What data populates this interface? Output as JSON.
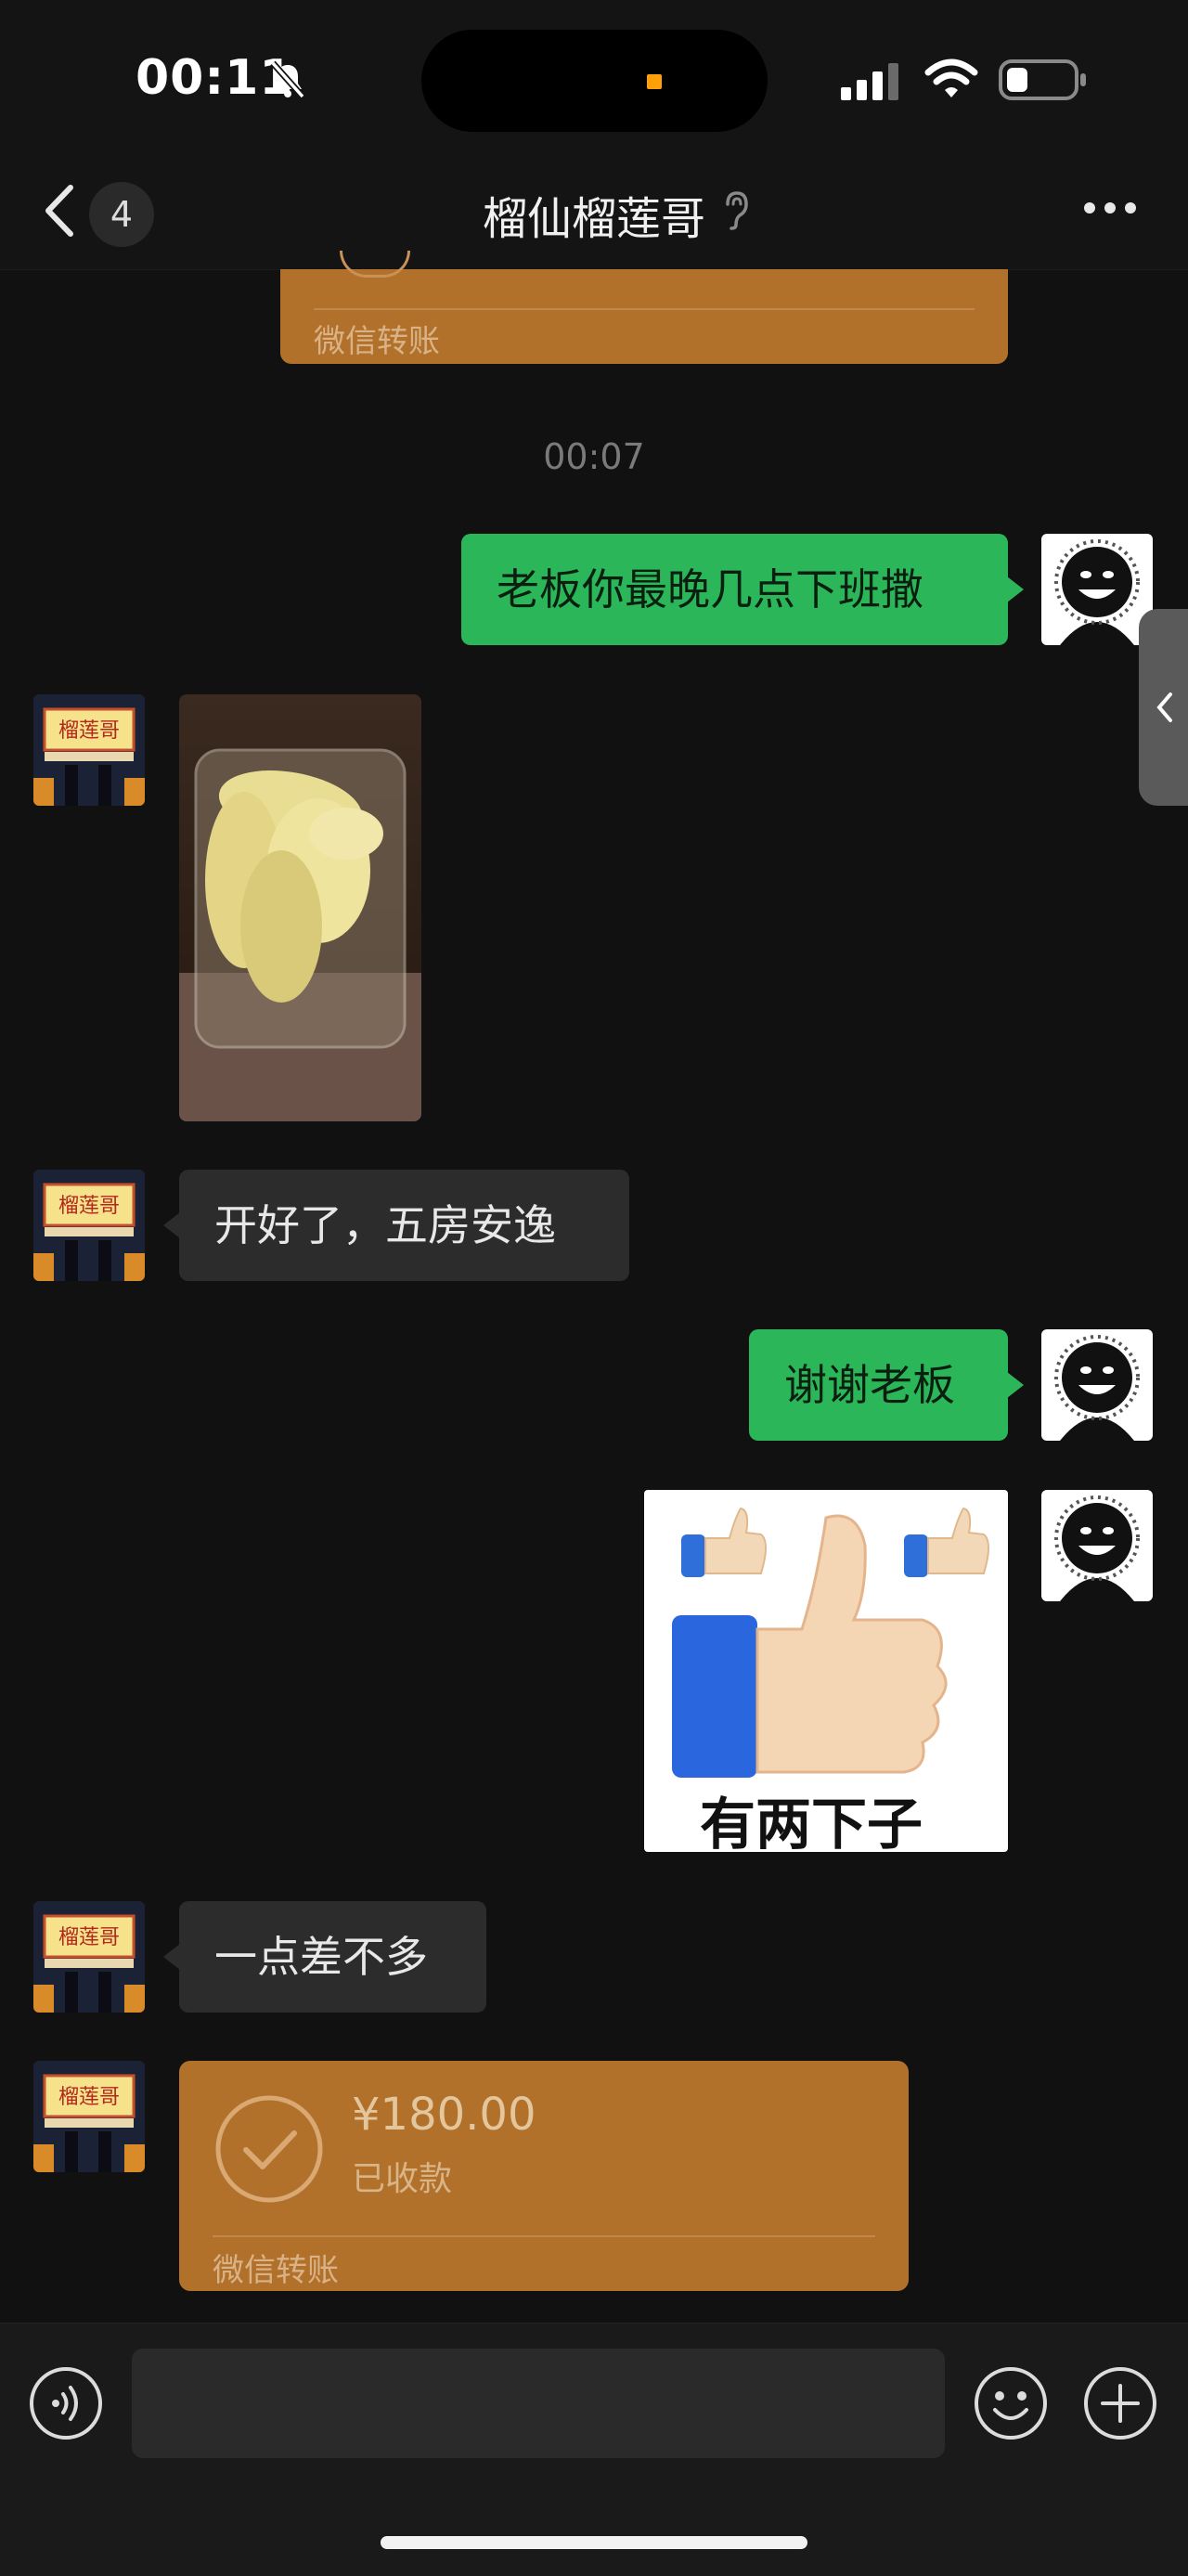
{
  "status_bar": {
    "time": "00:11"
  },
  "nav": {
    "back_badge": "4",
    "title": "榴仙榴莲哥"
  },
  "chat": {
    "top_transfer_footer": "微信转账",
    "time_separator": "00:07",
    "messages": [
      {
        "text": "老板你最晚几点下班撒"
      },
      {
        "text": "开好了，五房安逸"
      },
      {
        "text": "谢谢老板"
      },
      {
        "sticker_caption": "有两下子"
      },
      {
        "text": "一点差不多"
      }
    ],
    "transfer": {
      "amount": "¥180.00",
      "status": "已收款",
      "footer": "微信转账"
    },
    "shop_sign": "榴莲哥"
  },
  "colors": {
    "bubble_green": "#2bb759",
    "transfer": "#b2712b",
    "background": "#111111"
  }
}
